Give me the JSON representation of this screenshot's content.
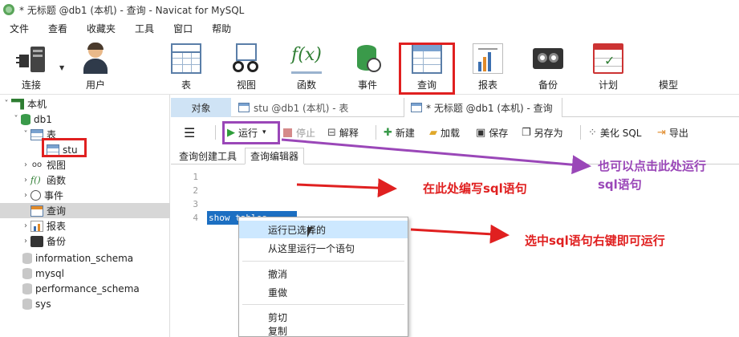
{
  "window": {
    "title": "* 无标题 @db1 (本机) - 查询 - Navicat for MySQL"
  },
  "menubar": {
    "items": [
      "文件",
      "查看",
      "收藏夹",
      "工具",
      "窗口",
      "帮助"
    ]
  },
  "ribbon": {
    "buttons": [
      {
        "label": "连接",
        "icon": "connection-icon"
      },
      {
        "label": "用户",
        "icon": "user-icon"
      },
      {
        "label": "表",
        "icon": "table-icon"
      },
      {
        "label": "视图",
        "icon": "view-icon"
      },
      {
        "label": "函数",
        "icon": "function-icon"
      },
      {
        "label": "事件",
        "icon": "event-icon"
      },
      {
        "label": "查询",
        "icon": "query-icon"
      },
      {
        "label": "报表",
        "icon": "report-icon"
      },
      {
        "label": "备份",
        "icon": "backup-icon"
      },
      {
        "label": "计划",
        "icon": "schedule-icon"
      },
      {
        "label": "模型",
        "icon": "model-icon"
      }
    ],
    "highlighted": "查询"
  },
  "sidebar": {
    "items": [
      {
        "label": "本机",
        "icon": "host-icon",
        "expander": "˅"
      },
      {
        "label": "db1",
        "icon": "database-icon",
        "expander": "˅"
      },
      {
        "label": "表",
        "icon": "table-folder-icon",
        "expander": "˅"
      },
      {
        "label": "stu",
        "icon": "table-icon",
        "expander": ""
      },
      {
        "label": "视图",
        "icon": "view-icon",
        "expander": "›"
      },
      {
        "label": "函数",
        "icon": "function-icon",
        "expander": "›"
      },
      {
        "label": "事件",
        "icon": "event-icon",
        "expander": "›"
      },
      {
        "label": "查询",
        "icon": "query-icon",
        "expander": ""
      },
      {
        "label": "报表",
        "icon": "report-icon",
        "expander": "›"
      },
      {
        "label": "备份",
        "icon": "backup-icon",
        "expander": "›"
      },
      {
        "label": "information_schema",
        "icon": "schema-icon",
        "expander": ""
      },
      {
        "label": "mysql",
        "icon": "schema-icon",
        "expander": ""
      },
      {
        "label": "performance_schema",
        "icon": "schema-icon",
        "expander": ""
      },
      {
        "label": "sys",
        "icon": "schema-icon",
        "expander": ""
      }
    ],
    "selected": "查询"
  },
  "tabs": {
    "objects": "对象",
    "stu_tab": "stu @db1 (本机) - 表",
    "query_tab": "* 无标题 @db1 (本机) - 查询"
  },
  "query_toolbar": {
    "menu_glyph": "☰",
    "run": "运行",
    "run_dropdown": "▾",
    "stop": "停止",
    "explain": "解释",
    "new": "新建",
    "load": "加载",
    "save": "保存",
    "save_as": "另存为",
    "beautify": "美化 SQL",
    "export": "导出"
  },
  "subtabs": {
    "builder": "查询创建工具",
    "editor": "查询编辑器"
  },
  "editor": {
    "line_numbers": [
      "1",
      "2",
      "3",
      "4"
    ],
    "selected_text": "show tables"
  },
  "context_menu": {
    "items": [
      "运行已选择的",
      "从这里运行一个语句",
      "撤消",
      "重做",
      "剪切",
      "复制"
    ],
    "hovered": "运行已选择的"
  },
  "annotations": {
    "run_hint_line1": "也可以点击此处运行",
    "run_hint_line2": "sql语句",
    "editor_hint": "在此处编写sql语句",
    "rightclick_hint": "选中sql语句右键即可运行"
  },
  "colors": {
    "highlight_red": "#e02020",
    "highlight_purple": "#9a47b8",
    "selection_blue": "#1c6fc2",
    "run_green": "#2e9e3a"
  }
}
